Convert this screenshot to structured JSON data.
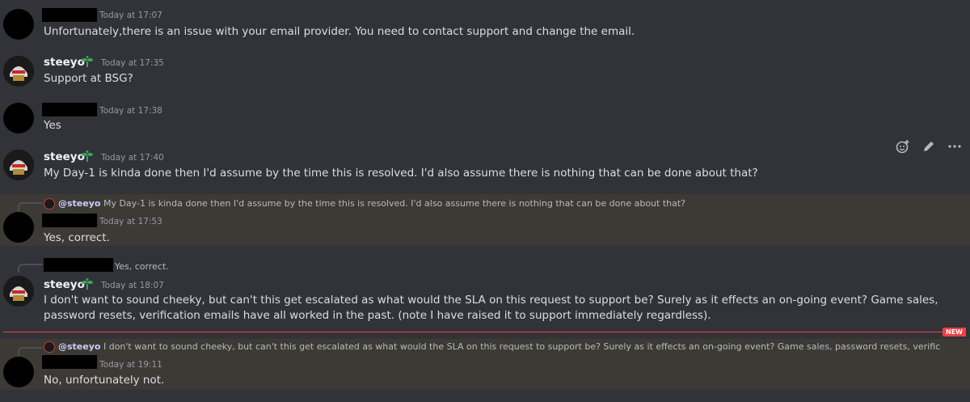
{
  "messages": [
    {
      "time": "Today at 17:07",
      "text": "Unfortunately,there is an issue with your email provider. You need to contact support and change the email."
    },
    {
      "author": "steeyo",
      "time": "Today at 17:35",
      "text": "Support at BSG?"
    },
    {
      "time": "Today at 17:38",
      "text": "Yes"
    },
    {
      "author": "steeyo",
      "time": "Today at 17:40",
      "text": "My Day-1 is kinda done then I'd assume by the time this is resolved.  I'd also assume there is nothing that can be done about that?"
    },
    {
      "reply_author": "@steeyo",
      "reply_text": "My Day-1 is kinda done then I'd assume by the time this is resolved. I'd also assume there is nothing that can be done about that?",
      "time": "Today at 17:53",
      "text": "Yes, correct."
    },
    {
      "reply_text": "Yes, correct.",
      "author": "steeyo",
      "time": "Today at 18:07",
      "text": "I don't want to sound cheeky, but can't this get escalated as what would the SLA on this request to support be? Surely as it effects an on-going event? Game sales, password resets, verification emails have all worked in the past. (note I have raised it to support immediately regardless)."
    },
    {
      "reply_author": "@steeyo",
      "reply_text": "I don't want to sound cheeky, but can't this get escalated as what would the SLA on this request to support be? Surely as it effects an on-going event? Game sales, password resets, verification ema",
      "time": "Today at 19:11",
      "text": "No, unfortunately not."
    }
  ],
  "new_label": "NEW",
  "icons": {
    "reaction": "add-reaction-icon",
    "edit": "edit-icon",
    "more": "more-icon"
  },
  "colors": {
    "bg": "#313338",
    "mention_bg": "#3d3a35",
    "new": "#f23f43",
    "badge": "#3ba55c"
  }
}
